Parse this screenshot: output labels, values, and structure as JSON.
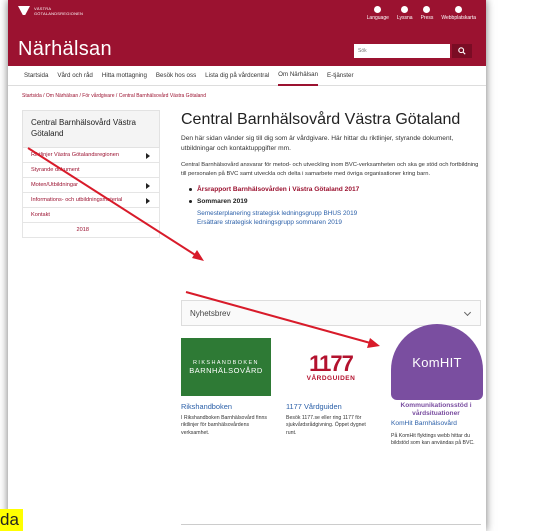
{
  "header": {
    "logo_text": "VÄSTRA GÖTALANDSREGIONEN",
    "site_title": "Närhälsan",
    "top_links": [
      {
        "label": "Language",
        "icon": "globe-icon"
      },
      {
        "label": "Lyssna",
        "icon": "ear-icon"
      },
      {
        "label": "Press",
        "icon": "pen-icon"
      },
      {
        "label": "Webbplatskarta",
        "icon": "sitemap-icon"
      }
    ],
    "search_placeholder": "Sök"
  },
  "nav": {
    "items": [
      "Startsida",
      "Vård och råd",
      "Hitta mottagning",
      "Besök hos oss",
      "Lista dig på vårdcentral",
      "Om Närhälsan",
      "E-tjänster"
    ]
  },
  "breadcrumb": "Startsida / Om Närhälsan / För vårdgivare / Central Barnhälsovård Västra Götaland",
  "sidebar": {
    "title": "Central Barnhälsovård Västra Götaland",
    "items": [
      "Riktlinjer Västra Götalandsregionen",
      "Styrande dokument",
      "Moten/Utbildningar",
      "Informations- och utbildningsmaterial",
      "Kontakt",
      "2018"
    ]
  },
  "main": {
    "title": "Central Barnhälsovård Västra Götaland",
    "intro": "Den här sidan vänder sig till dig som är vårdgivare. Här hittar du riktlinjer, styrande dokument, utbildningar och kontaktuppgifter mm.",
    "body": "Central Barnhälsovård ansvarar för metod- och utveckling inom BVC-verksamheten och ska ge stöd och fortbildning till personalen på BVC samt utveckla och delta i samarbete med övriga organisationer kring barn.",
    "bullet1": "Årsrapport Barnhälsovården i Västra Götaland 2017",
    "bullet2": "Sommaren 2019",
    "sublink1": "Semesterplanering strategisk ledningsgrupp BHUS 2019",
    "sublink2": "Ersättare strategisk ledningsgrupp sommaren 2019",
    "accordion_label": "Nyhetsbrev"
  },
  "cards": {
    "rik": {
      "logo_line1": "RIKSHANDBOKEN",
      "logo_line2": "BARNHÄLSOVÅRD",
      "title": "Rikshandboken",
      "text": "I Rikshandboken Barnhälsovård finns riktlinjer för barnhälsovårdens verksamhet."
    },
    "vard": {
      "logo_number": "1177",
      "logo_sub": "VÅRDGUIDEN",
      "title": "1177 Vårdguiden",
      "text": "Besök 1177.se eller ring 1177 för sjukvårdsrådgivning. Öppet dygnet runt."
    },
    "komhit": {
      "logo": "KomHIT",
      "tagline": "Kommunikationsstöd i vårdsituationer",
      "title": "KomHit Barnhälsovård",
      "text": "På KomHit flyktings webb hittar du bildstöd som kan användas på BVC."
    }
  },
  "overlay": {
    "highlight_text": "da",
    "arrow_color": "#d81b2a",
    "highlight_color": "#ffff00"
  },
  "colors": {
    "brand": "#9b1230",
    "link": "#2a5fa8",
    "komhit": "#7a4ea0",
    "rik_green": "#2e7a35"
  }
}
